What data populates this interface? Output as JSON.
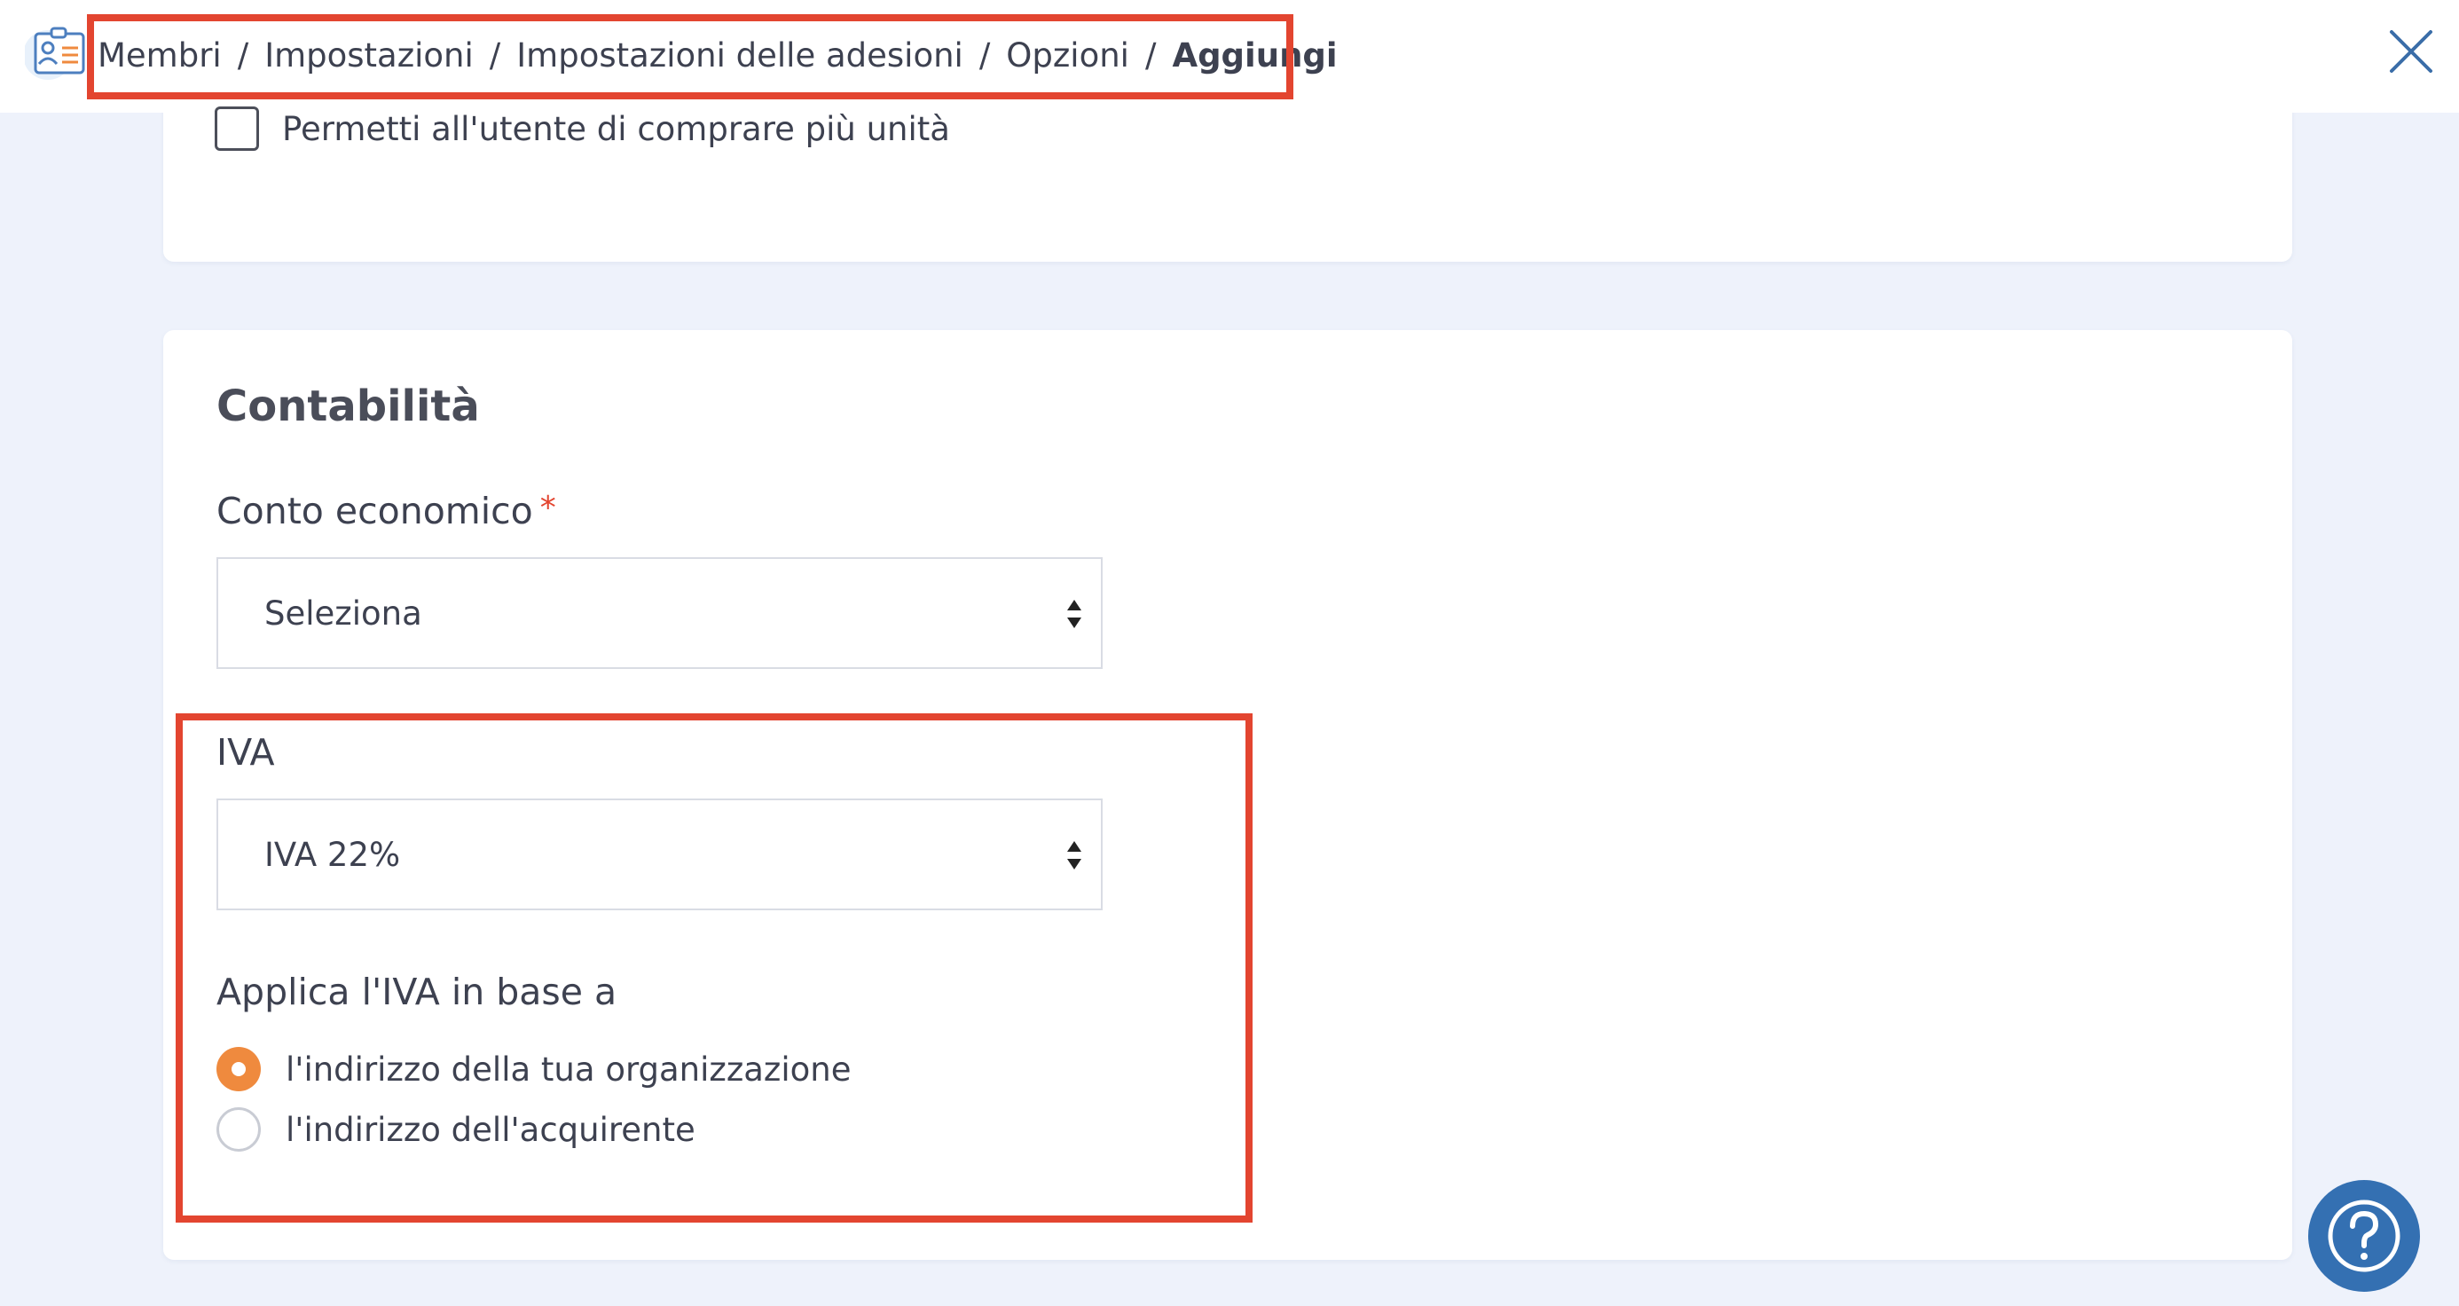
{
  "header": {
    "app_icon": "membership-card-icon",
    "breadcrumb": [
      "Membri",
      "Impostazioni",
      "Impostazioni delle adesioni",
      "Opzioni"
    ],
    "breadcrumb_current": "Aggiungi",
    "separator": "/",
    "close_icon": "close-icon"
  },
  "options_card": {
    "checkbox_label": "Permetti all'utente di comprare più unità",
    "checkbox_checked": false
  },
  "accounting": {
    "title": "Contabilità",
    "income_account": {
      "label": "Conto economico",
      "required_mark": "*",
      "value": "Seleziona"
    },
    "vat": {
      "label": "IVA",
      "value": "IVA 22%"
    },
    "apply_vat": {
      "label": "Applica l'IVA in base a",
      "options": [
        {
          "label": "l'indirizzo della tua organizzazione",
          "selected": true
        },
        {
          "label": "l'indirizzo dell'acquirente",
          "selected": false
        }
      ]
    }
  },
  "help_button": {
    "icon": "help-question-icon"
  },
  "colors": {
    "accent_orange": "#ef8a3e",
    "highlight_red": "#e34530",
    "help_blue": "#3470b2",
    "close_blue": "#3a6da8"
  }
}
